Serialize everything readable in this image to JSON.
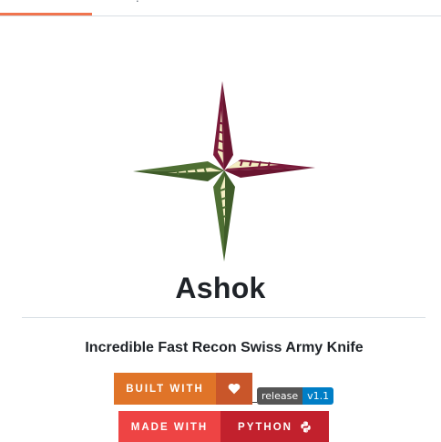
{
  "top_tabs": {
    "active_color": "#f0744e",
    "fragment_text": "."
  },
  "readme": {
    "title": "Ashok",
    "tagline": "Incredible Fast Recon Swiss Army Knife",
    "logo": {
      "icon": "compass-star-logo",
      "colors": {
        "maroon": "#7a1a3a",
        "green": "#4e6f33",
        "cream": "#f4eec2"
      }
    },
    "badges": {
      "built_with": {
        "label": "BUILT WITH",
        "icon": "heart-icon",
        "left_color": "#e07428",
        "right_color": "#c9562a"
      },
      "release": {
        "label": "release",
        "value": "v1.1",
        "left_color": "#555555",
        "right_color": "#007ec6"
      },
      "made_with": {
        "label": "MADE WITH",
        "value": "PYTHON",
        "icon": "python-icon",
        "left_color": "#ee4444",
        "right_color": "#c2212d"
      }
    }
  }
}
